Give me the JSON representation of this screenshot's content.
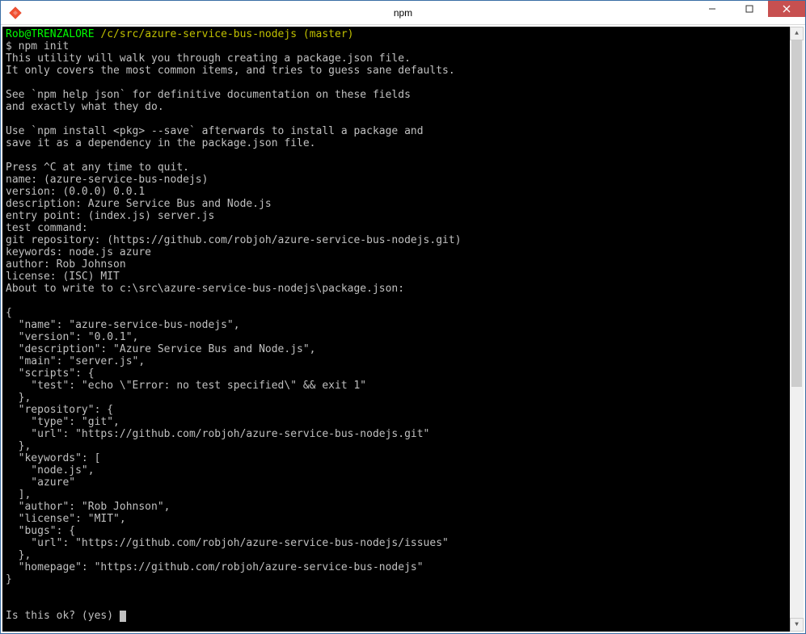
{
  "window": {
    "title": "npm"
  },
  "prompt": {
    "user_host": "Rob@TRENZALORE",
    "path": "/c/src/azure-service-bus-nodejs",
    "branch": "(master)",
    "symbol": "$",
    "command": "npm init"
  },
  "lines": {
    "l1": "This utility will walk you through creating a package.json file.",
    "l2": "It only covers the most common items, and tries to guess sane defaults.",
    "l3": "",
    "l4": "See `npm help json` for definitive documentation on these fields",
    "l5": "and exactly what they do.",
    "l6": "",
    "l7": "Use `npm install <pkg> --save` afterwards to install a package and",
    "l8": "save it as a dependency in the package.json file.",
    "l9": "",
    "l10": "Press ^C at any time to quit.",
    "l11": "name: (azure-service-bus-nodejs)",
    "l12": "version: (0.0.0) 0.0.1",
    "l13": "description: Azure Service Bus and Node.js",
    "l14": "entry point: (index.js) server.js",
    "l15": "test command:",
    "l16": "git repository: (https://github.com/robjoh/azure-service-bus-nodejs.git)",
    "l17": "keywords: node.js azure",
    "l18": "author: Rob Johnson",
    "l19": "license: (ISC) MIT",
    "l20": "About to write to c:\\src\\azure-service-bus-nodejs\\package.json:",
    "l21": "",
    "l22": "{",
    "l23": "  \"name\": \"azure-service-bus-nodejs\",",
    "l24": "  \"version\": \"0.0.1\",",
    "l25": "  \"description\": \"Azure Service Bus and Node.js\",",
    "l26": "  \"main\": \"server.js\",",
    "l27": "  \"scripts\": {",
    "l28": "    \"test\": \"echo \\\"Error: no test specified\\\" && exit 1\"",
    "l29": "  },",
    "l30": "  \"repository\": {",
    "l31": "    \"type\": \"git\",",
    "l32": "    \"url\": \"https://github.com/robjoh/azure-service-bus-nodejs.git\"",
    "l33": "  },",
    "l34": "  \"keywords\": [",
    "l35": "    \"node.js\",",
    "l36": "    \"azure\"",
    "l37": "  ],",
    "l38": "  \"author\": \"Rob Johnson\",",
    "l39": "  \"license\": \"MIT\",",
    "l40": "  \"bugs\": {",
    "l41": "    \"url\": \"https://github.com/robjoh/azure-service-bus-nodejs/issues\"",
    "l42": "  },",
    "l43": "  \"homepage\": \"https://github.com/robjoh/azure-service-bus-nodejs\"",
    "l44": "}",
    "l45": "",
    "l46": "",
    "l47": "Is this ok? (yes) "
  }
}
